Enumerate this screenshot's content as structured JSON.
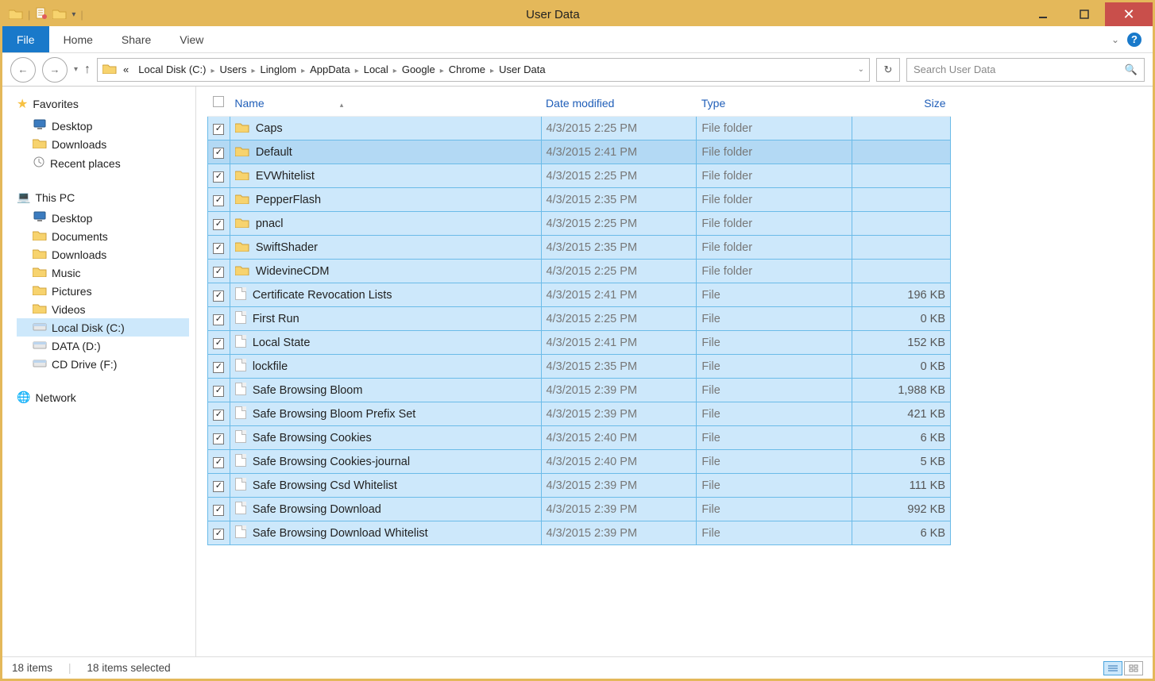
{
  "window": {
    "title": "User Data"
  },
  "ribbon": {
    "file": "File",
    "home": "Home",
    "share": "Share",
    "view": "View"
  },
  "breadcrumb": [
    "Local Disk (C:)",
    "Users",
    "Linglom",
    "AppData",
    "Local",
    "Google",
    "Chrome",
    "User Data"
  ],
  "search": {
    "placeholder": "Search User Data"
  },
  "nav": {
    "favorites": {
      "label": "Favorites",
      "items": [
        "Desktop",
        "Downloads",
        "Recent places"
      ]
    },
    "thispc": {
      "label": "This PC",
      "items": [
        "Desktop",
        "Documents",
        "Downloads",
        "Music",
        "Pictures",
        "Videos",
        "Local Disk (C:)",
        "DATA (D:)",
        "CD Drive (F:)"
      ],
      "selected": "Local Disk (C:)"
    },
    "network": {
      "label": "Network"
    }
  },
  "columns": {
    "name": "Name",
    "date": "Date modified",
    "type": "Type",
    "size": "Size"
  },
  "rows": [
    {
      "icon": "folder",
      "name": "Caps",
      "date": "4/3/2015 2:25 PM",
      "type": "File folder",
      "size": ""
    },
    {
      "icon": "folder",
      "name": "Default",
      "date": "4/3/2015 2:41 PM",
      "type": "File folder",
      "size": "",
      "hover": true
    },
    {
      "icon": "folder",
      "name": "EVWhitelist",
      "date": "4/3/2015 2:25 PM",
      "type": "File folder",
      "size": ""
    },
    {
      "icon": "folder",
      "name": "PepperFlash",
      "date": "4/3/2015 2:35 PM",
      "type": "File folder",
      "size": ""
    },
    {
      "icon": "folder",
      "name": "pnacl",
      "date": "4/3/2015 2:25 PM",
      "type": "File folder",
      "size": ""
    },
    {
      "icon": "folder",
      "name": "SwiftShader",
      "date": "4/3/2015 2:35 PM",
      "type": "File folder",
      "size": ""
    },
    {
      "icon": "folder",
      "name": "WidevineCDM",
      "date": "4/3/2015 2:25 PM",
      "type": "File folder",
      "size": ""
    },
    {
      "icon": "file",
      "name": "Certificate Revocation Lists",
      "date": "4/3/2015 2:41 PM",
      "type": "File",
      "size": "196 KB"
    },
    {
      "icon": "file",
      "name": "First Run",
      "date": "4/3/2015 2:25 PM",
      "type": "File",
      "size": "0 KB"
    },
    {
      "icon": "file",
      "name": "Local State",
      "date": "4/3/2015 2:41 PM",
      "type": "File",
      "size": "152 KB"
    },
    {
      "icon": "file",
      "name": "lockfile",
      "date": "4/3/2015 2:35 PM",
      "type": "File",
      "size": "0 KB"
    },
    {
      "icon": "file",
      "name": "Safe Browsing Bloom",
      "date": "4/3/2015 2:39 PM",
      "type": "File",
      "size": "1,988 KB"
    },
    {
      "icon": "file",
      "name": "Safe Browsing Bloom Prefix Set",
      "date": "4/3/2015 2:39 PM",
      "type": "File",
      "size": "421 KB"
    },
    {
      "icon": "file",
      "name": "Safe Browsing Cookies",
      "date": "4/3/2015 2:40 PM",
      "type": "File",
      "size": "6 KB"
    },
    {
      "icon": "file",
      "name": "Safe Browsing Cookies-journal",
      "date": "4/3/2015 2:40 PM",
      "type": "File",
      "size": "5 KB"
    },
    {
      "icon": "file",
      "name": "Safe Browsing Csd Whitelist",
      "date": "4/3/2015 2:39 PM",
      "type": "File",
      "size": "111 KB"
    },
    {
      "icon": "file",
      "name": "Safe Browsing Download",
      "date": "4/3/2015 2:39 PM",
      "type": "File",
      "size": "992 KB"
    },
    {
      "icon": "file",
      "name": "Safe Browsing Download Whitelist",
      "date": "4/3/2015 2:39 PM",
      "type": "File",
      "size": "6 KB"
    }
  ],
  "status": {
    "count": "18 items",
    "selected": "18 items selected"
  }
}
